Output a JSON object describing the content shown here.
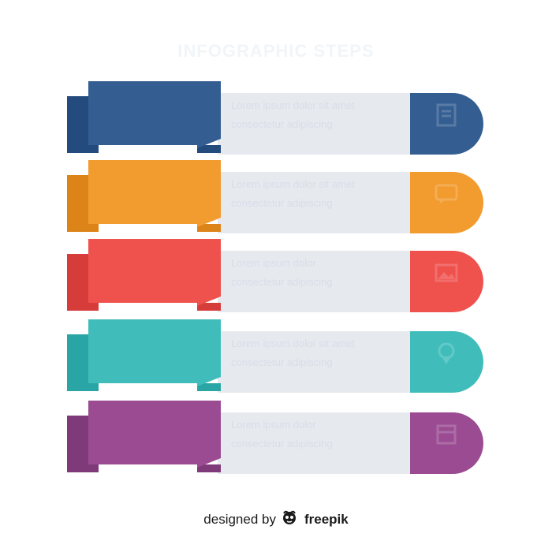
{
  "title": "INFOGRAPHIC STEPS",
  "steps": [
    {
      "color": "#345e91",
      "dark": "#234b7d",
      "icon": "document-icon",
      "ribbon_text": "",
      "lines": [
        "Lorem ipsum dolor sit amet",
        "consectetur adipiscing"
      ]
    },
    {
      "color": "#f29b2f",
      "dark": "#dd8418",
      "icon": "chat-icon",
      "ribbon_text": "",
      "lines": [
        "Lorem ipsum dolor sit amet",
        "consectetur adipiscing"
      ]
    },
    {
      "color": "#ef514d",
      "dark": "#d63c3a",
      "icon": "image-icon",
      "ribbon_text": "",
      "lines": [
        "Lorem ipsum dolor",
        "consectetur adipiscing"
      ]
    },
    {
      "color": "#40bdbb",
      "dark": "#2aa5a5",
      "icon": "pin-icon",
      "ribbon_text": "",
      "lines": [
        "Lorem ipsum dolor sit amet",
        "consectetur adipiscing"
      ]
    },
    {
      "color": "#9a4b92",
      "dark": "#7f3a7a",
      "icon": "box-icon",
      "ribbon_text": "",
      "lines": [
        "Lorem ipsum dolor",
        "consectetur adipiscing"
      ]
    }
  ],
  "credit": {
    "prefix": "designed by",
    "brand": "freepik"
  }
}
